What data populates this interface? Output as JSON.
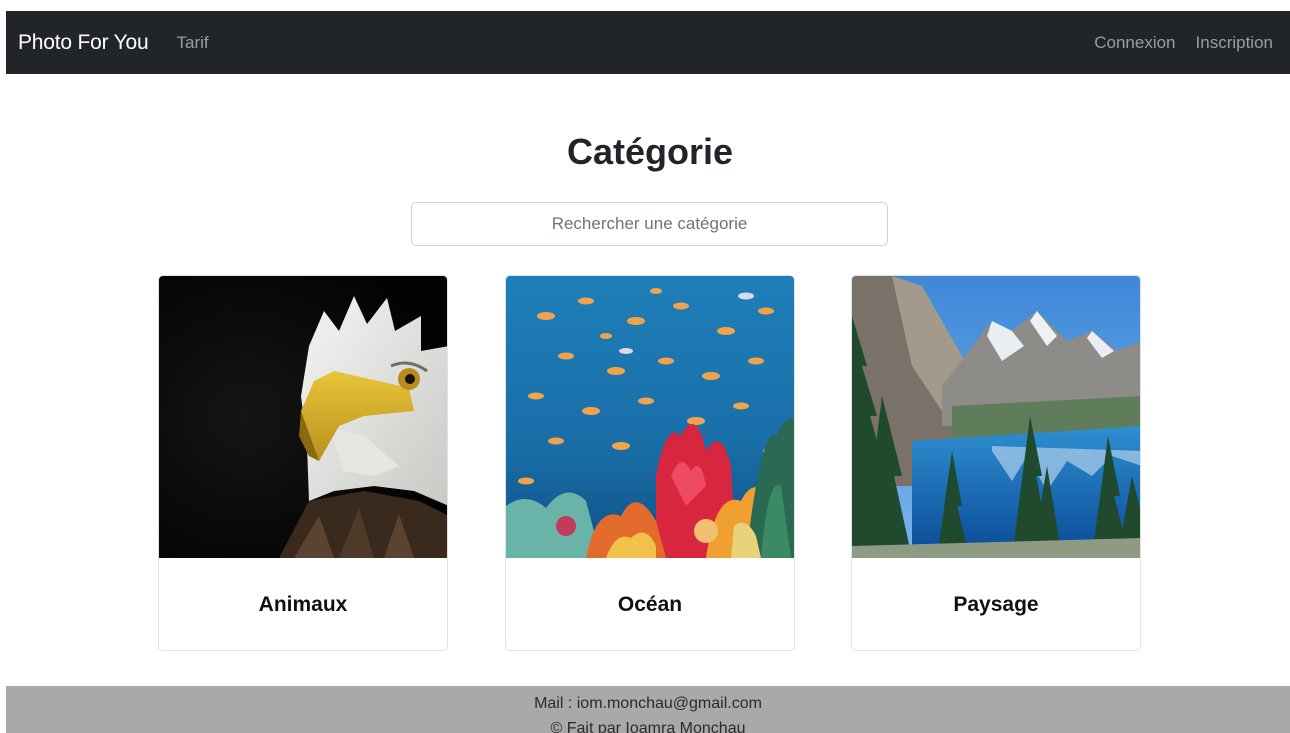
{
  "navbar": {
    "brand": "Photo For You",
    "links": [
      {
        "label": "Tarif"
      }
    ],
    "right_links": [
      {
        "label": "Connexion"
      },
      {
        "label": "Inscription"
      }
    ]
  },
  "main": {
    "title": "Catégorie",
    "search": {
      "value": "",
      "placeholder": "Rechercher une catégorie"
    },
    "categories": [
      {
        "label": "Animaux",
        "icon": "eagle-photo"
      },
      {
        "label": "Océan",
        "icon": "coral-reef-photo"
      },
      {
        "label": "Paysage",
        "icon": "mountain-lake-photo"
      }
    ]
  },
  "footer": {
    "mail": "Mail : iom.monchau@gmail.com",
    "credit": "© Fait par Ioamra Monchau"
  },
  "colors": {
    "navbar_bg": "#212529",
    "footer_bg": "#a9a9a9",
    "nav_link": "#9a9da0"
  }
}
